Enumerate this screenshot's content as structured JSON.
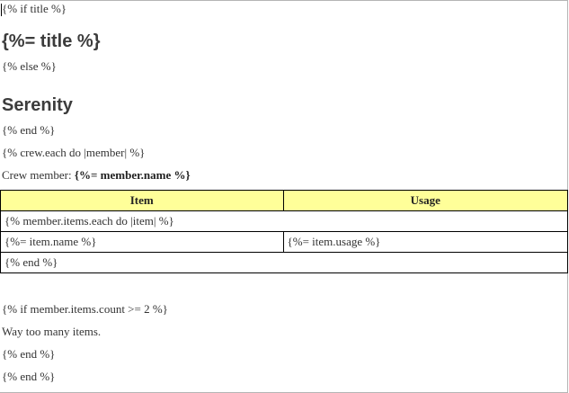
{
  "document": {
    "lines": {
      "if_title": "{% if title %}",
      "title_expr": "{%= title %}",
      "else": "{% else %}",
      "heading": "Serenity",
      "end_1": "{% end %}",
      "crew_each": "{% crew.each do |member| %}",
      "crew_member_label": "Crew member:",
      "member_name_expr": "{%= member.name %}"
    },
    "table": {
      "headers": [
        "Item",
        "Usage"
      ],
      "header_bg": "#ffff99",
      "rows": {
        "items_each": "{% member.items.each do |item| %}",
        "item_name": "{%= item.name %}",
        "item_usage": "{%= item.usage %}",
        "items_end": "{% end %}"
      }
    },
    "after_table": {
      "if_count": "{% if member.items.count >= 2 %}",
      "too_many": "Way too many items.",
      "end_2": "{% end %}",
      "end_3": "{% end %}"
    }
  }
}
